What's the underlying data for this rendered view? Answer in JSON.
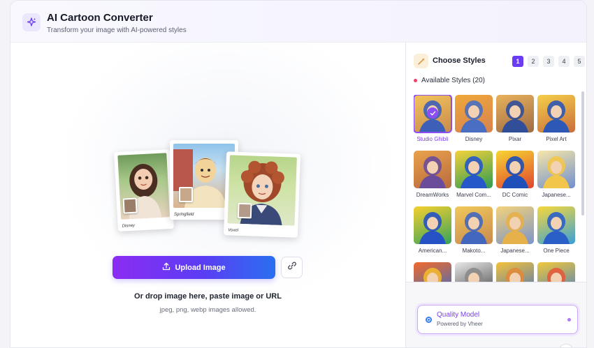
{
  "header": {
    "title": "AI Cartoon Converter",
    "subtitle": "Transform your image with AI-powered styles",
    "icon": "sparkle-icon"
  },
  "preview": {
    "cards": [
      {
        "caption": "Disney"
      },
      {
        "caption": "Springfield"
      },
      {
        "caption": "Voxel"
      }
    ]
  },
  "upload": {
    "button_label": "Upload Image",
    "drop_text": "Or drop image here, paste image or URL",
    "hint": "jpeg, png, webp images allowed."
  },
  "styles": {
    "title": "Choose Styles",
    "pages": [
      "1",
      "2",
      "3",
      "4",
      "5"
    ],
    "active_page": "1",
    "available_label": "Available Styles (20)",
    "items": [
      {
        "label": "Studio Ghibli",
        "selected": true,
        "palette": [
          "#f2c45a",
          "#3d5fb8",
          "#c98a4f"
        ]
      },
      {
        "label": "Disney",
        "selected": false,
        "palette": [
          "#f0a83a",
          "#4a6fc2",
          "#d6824f"
        ]
      },
      {
        "label": "Pixar",
        "selected": false,
        "palette": [
          "#e8b25c",
          "#314f99",
          "#9e6b44"
        ]
      },
      {
        "label": "Pixel Art",
        "selected": false,
        "palette": [
          "#f5cf4a",
          "#2e58b5",
          "#c96d3b"
        ]
      },
      {
        "label": "DreamWorks",
        "selected": false,
        "palette": [
          "#e9a24c",
          "#6b4c9a",
          "#b86a3e"
        ]
      },
      {
        "label": "Marvel Com...",
        "selected": false,
        "palette": [
          "#f4d23a",
          "#2658c9",
          "#2e9b52"
        ]
      },
      {
        "label": "DC Comic",
        "selected": false,
        "palette": [
          "#f6d532",
          "#1f4fb8",
          "#e0452f"
        ]
      },
      {
        "label": "Japanese...",
        "selected": false,
        "palette": [
          "#f7e6a8",
          "#f2c64a",
          "#6f8fce"
        ]
      },
      {
        "label": "American...",
        "selected": false,
        "palette": [
          "#f5d02e",
          "#2552c4",
          "#37a35b"
        ]
      },
      {
        "label": "Makoto...",
        "selected": false,
        "palette": [
          "#f0c85a",
          "#4467be",
          "#c98a4f"
        ]
      },
      {
        "label": "Japanese...",
        "selected": false,
        "palette": [
          "#f3d27a",
          "#e6b04a",
          "#7c95c9"
        ]
      },
      {
        "label": "One Piece",
        "selected": false,
        "palette": [
          "#f7d83a",
          "#2a5fc8",
          "#39a0d8"
        ]
      },
      {
        "label": "",
        "selected": false,
        "palette": [
          "#f26a2a",
          "#f2b82e",
          "#2a6ed0"
        ]
      },
      {
        "label": "",
        "selected": false,
        "palette": [
          "#e8e8e8",
          "#8a8a8a",
          "#3a3a3a"
        ]
      },
      {
        "label": "",
        "selected": false,
        "palette": [
          "#f5c23a",
          "#e08a3a",
          "#3a6fc8"
        ]
      },
      {
        "label": "",
        "selected": false,
        "palette": [
          "#f2c83a",
          "#e45a3a",
          "#3a78d0"
        ]
      }
    ]
  },
  "model": {
    "name": "Quality Model",
    "powered_by": "Powered by Vheer"
  },
  "colors": {
    "accent": "#6a3df4",
    "selected": "#8b4ef2",
    "button_start": "#8c2cf2",
    "button_end": "#2a6ff0"
  }
}
